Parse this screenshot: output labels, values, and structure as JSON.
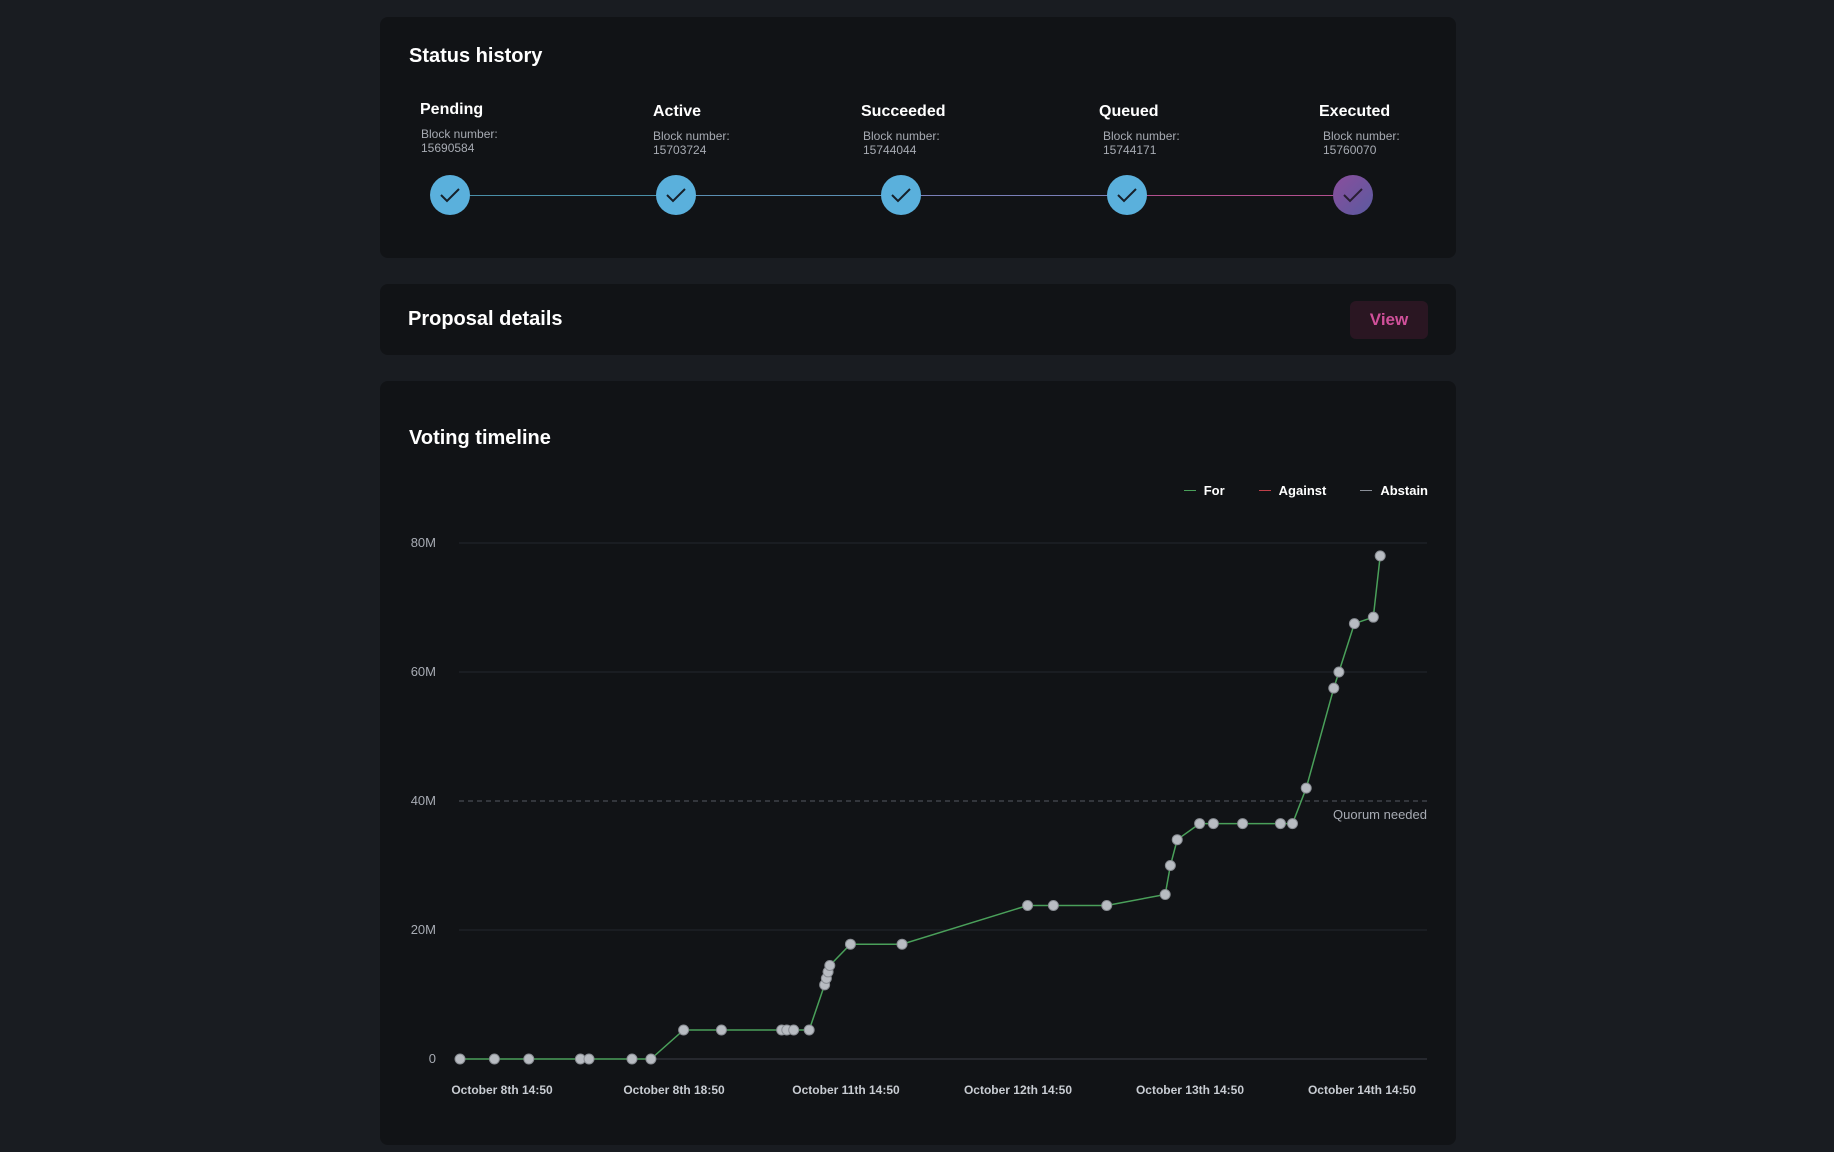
{
  "status_history": {
    "title": "Status history",
    "block_label": "Block number:",
    "steps": [
      {
        "name": "Pending",
        "block": "15690584",
        "color": "#5ab0dc"
      },
      {
        "name": "Active",
        "block": "15703724",
        "color": "#5ab0dc"
      },
      {
        "name": "Succeeded",
        "block": "15744044",
        "color": "#5ab0dc"
      },
      {
        "name": "Queued",
        "block": "15744171",
        "color": "#5ab0dc"
      },
      {
        "name": "Executed",
        "block": "15760070",
        "color": "#7a4b9e"
      }
    ],
    "icon": "check-icon"
  },
  "proposal_details": {
    "title": "Proposal details",
    "view_label": "View",
    "accent": "#d0509a"
  },
  "voting_timeline": {
    "title": "Voting timeline",
    "legend": [
      {
        "label": "For",
        "color": "#4aa05a"
      },
      {
        "label": "Against",
        "color": "#c0404a"
      },
      {
        "label": "Abstain",
        "color": "#8a8f98"
      }
    ],
    "quorum_label": "Quorum needed"
  },
  "chart_data": {
    "type": "line",
    "title": "Voting timeline",
    "xlabel": "",
    "ylabel": "",
    "y_ticks": [
      "0",
      "20M",
      "40M",
      "60M",
      "80M"
    ],
    "ylim": [
      0,
      80
    ],
    "y_unit": "M",
    "x_ticks": [
      "October 8th 14:50",
      "October 8th 18:50",
      "October 11th 14:50",
      "October 12th 14:50",
      "October 13th 14:50",
      "October 14th 14:50"
    ],
    "quorum": 40,
    "grid": true,
    "legend_position": "top-right",
    "series": [
      {
        "name": "For",
        "color": "#4aa05a",
        "points": [
          {
            "x": 0.0,
            "y": 0
          },
          {
            "x": 0.2,
            "y": 0
          },
          {
            "x": 0.4,
            "y": 0
          },
          {
            "x": 0.7,
            "y": 0
          },
          {
            "x": 0.75,
            "y": 0
          },
          {
            "x": 1.0,
            "y": 0
          },
          {
            "x": 1.11,
            "y": 0
          },
          {
            "x": 1.3,
            "y": 4.5
          },
          {
            "x": 1.52,
            "y": 4.5
          },
          {
            "x": 1.87,
            "y": 4.5
          },
          {
            "x": 1.9,
            "y": 4.5
          },
          {
            "x": 1.94,
            "y": 4.5
          },
          {
            "x": 2.03,
            "y": 4.5
          },
          {
            "x": 2.12,
            "y": 11.5
          },
          {
            "x": 2.13,
            "y": 12.5
          },
          {
            "x": 2.14,
            "y": 13.5
          },
          {
            "x": 2.15,
            "y": 14.5
          },
          {
            "x": 2.27,
            "y": 17.8
          },
          {
            "x": 2.57,
            "y": 17.8
          },
          {
            "x": 3.3,
            "y": 23.8
          },
          {
            "x": 3.45,
            "y": 23.8
          },
          {
            "x": 3.76,
            "y": 23.8
          },
          {
            "x": 4.1,
            "y": 25.5
          },
          {
            "x": 4.13,
            "y": 30
          },
          {
            "x": 4.17,
            "y": 34
          },
          {
            "x": 4.3,
            "y": 36.5
          },
          {
            "x": 4.38,
            "y": 36.5
          },
          {
            "x": 4.55,
            "y": 36.5
          },
          {
            "x": 4.77,
            "y": 36.5
          },
          {
            "x": 4.84,
            "y": 36.5
          },
          {
            "x": 4.92,
            "y": 42
          },
          {
            "x": 5.08,
            "y": 57.5
          },
          {
            "x": 5.11,
            "y": 60
          },
          {
            "x": 5.2,
            "y": 67.5
          },
          {
            "x": 5.31,
            "y": 68.5
          },
          {
            "x": 5.35,
            "y": 78
          }
        ]
      }
    ]
  }
}
